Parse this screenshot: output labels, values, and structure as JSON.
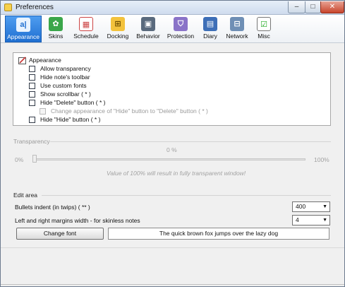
{
  "window": {
    "title": "Preferences",
    "minimize_glyph": "–",
    "maximize_glyph": "□",
    "close_glyph": "✕"
  },
  "toolbar": {
    "tabs": [
      {
        "label": "Appearance",
        "icon": "appearance-icon",
        "glyph": "a|",
        "active": true
      },
      {
        "label": "Skins",
        "icon": "skins-icon",
        "glyph": "✿",
        "active": false
      },
      {
        "label": "Schedule",
        "icon": "schedule-icon",
        "glyph": "▦",
        "active": false
      },
      {
        "label": "Docking",
        "icon": "docking-icon",
        "glyph": "⊞",
        "active": false
      },
      {
        "label": "Behavior",
        "icon": "behavior-icon",
        "glyph": "▣",
        "active": false
      },
      {
        "label": "Protection",
        "icon": "protection-icon",
        "glyph": "⛉",
        "active": false
      },
      {
        "label": "Diary",
        "icon": "diary-icon",
        "glyph": "▤",
        "active": false
      },
      {
        "label": "Network",
        "icon": "network-icon",
        "glyph": "⊟",
        "active": false
      },
      {
        "label": "Misc",
        "icon": "misc-icon",
        "glyph": "☑",
        "active": false
      }
    ]
  },
  "appearance": {
    "root_label": "Appearance",
    "options": [
      {
        "label": "Allow transparency",
        "checked": false,
        "enabled": true
      },
      {
        "label": "Hide note's toolbar",
        "checked": false,
        "enabled": true
      },
      {
        "label": "Use custom fonts",
        "checked": false,
        "enabled": true
      },
      {
        "label": "Show scrollbar ( * )",
        "checked": false,
        "enabled": true
      },
      {
        "label": "Hide \"Delete\" button ( * )",
        "checked": false,
        "enabled": true
      },
      {
        "label": "Change appearance of \"Hide\" button to \"Delete\" button ( * )",
        "checked": false,
        "enabled": false
      },
      {
        "label": "Hide \"Hide\" button ( * )",
        "checked": false,
        "enabled": true
      }
    ]
  },
  "transparency": {
    "title": "Transparency",
    "current_value": "0 %",
    "min_label": "0%",
    "max_label": "100%",
    "level": 0,
    "hint": "Value of 100% will result in fully transparent window!"
  },
  "edit_area": {
    "title": "Edit area",
    "bullets_label": "Bullets indent (in twips) ( ** )",
    "bullets_value": "400",
    "margins_label": "Left and right margins width - for skinless notes",
    "margins_value": "4",
    "change_font_label": "Change font",
    "preview_text": "The quick brown fox jumps over the lazy dog"
  },
  "colors": {
    "active_tab": "#1f6fd1",
    "close_button": "#c8452c"
  }
}
